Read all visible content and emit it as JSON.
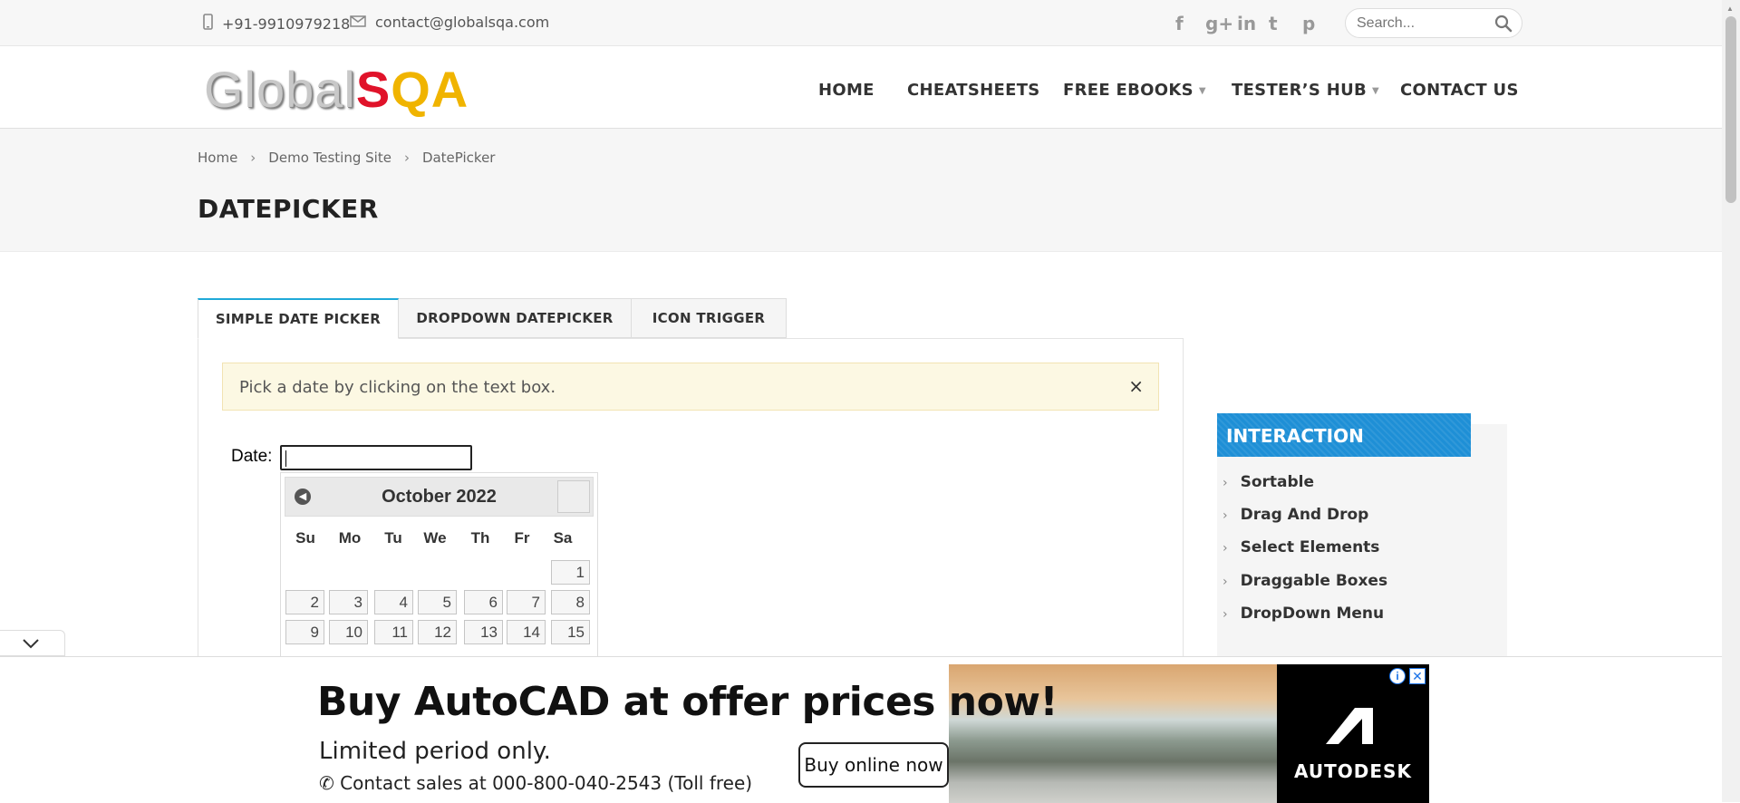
{
  "topbar": {
    "phone": "+91-9910979218",
    "email": "contact@globalsqa.com",
    "social": [
      "f",
      "g+",
      "in",
      "t",
      "p"
    ],
    "search_placeholder": "Search..."
  },
  "header": {
    "logo_part1": "Global",
    "logo_part2": "S",
    "logo_part3": "QA",
    "nav": [
      "HOME",
      "CHEATSHEETS",
      "FREE EBOOKS",
      "TESTER’S HUB",
      "CONTACT US"
    ]
  },
  "breadcrumb": [
    "Home",
    "Demo Testing Site",
    "DatePicker"
  ],
  "page_title": "DATEPICKER",
  "tabs": [
    "SIMPLE DATE PICKER",
    "DROPDOWN DATEPICKER",
    "ICON TRIGGER"
  ],
  "alert": {
    "message": "Pick a date by clicking on the text box.",
    "close": "×"
  },
  "date_label": "Date:",
  "calendar": {
    "title": "October 2022",
    "prev": "◀",
    "weekdays": [
      "Su",
      "Mo",
      "Tu",
      "We",
      "Th",
      "Fr",
      "Sa"
    ],
    "days": [
      "1",
      "2",
      "3",
      "4",
      "5",
      "6",
      "7",
      "8",
      "9",
      "10",
      "11",
      "12",
      "13",
      "14",
      "15"
    ]
  },
  "sidebar": {
    "heading": "INTERACTION",
    "items": [
      "Sortable",
      "Drag And Drop",
      "Select Elements",
      "Draggable Boxes",
      "DropDown Menu"
    ]
  },
  "ad": {
    "headline": "Buy AutoCAD at offer prices now!",
    "sub": "Limited period only.",
    "contact": "Contact sales at 000-800-040-2543 (Toll free)",
    "button": "Buy online now",
    "brand": "AUTODESK",
    "close": "✕",
    "info": "i"
  }
}
